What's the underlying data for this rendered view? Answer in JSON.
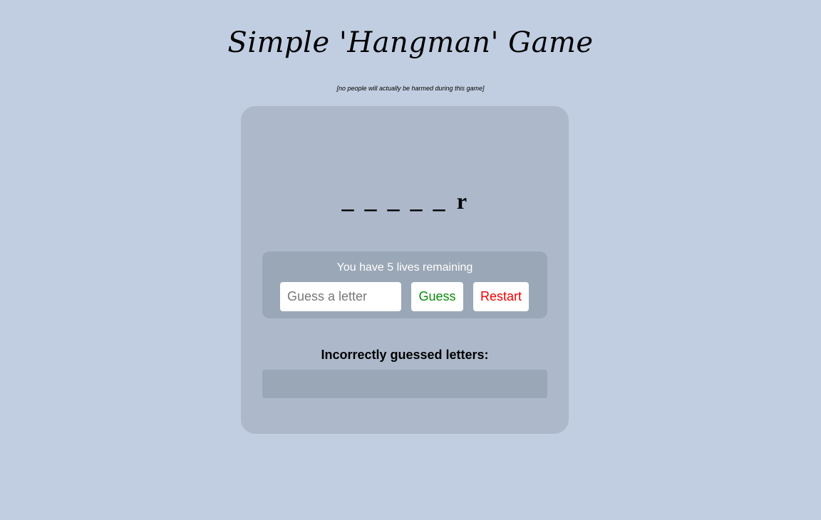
{
  "header": {
    "title": "Simple 'Hangman' Game",
    "subtitle": "[no people will actually be harmed during this game]"
  },
  "word": {
    "slots": [
      "_",
      "_",
      "_",
      "_",
      "_",
      "r"
    ]
  },
  "controls": {
    "lives_text": "You have 5 lives remaining",
    "guess_placeholder": "Guess a letter",
    "guess_value": "",
    "guess_button_label": "Guess",
    "restart_button_label": "Restart"
  },
  "incorrect": {
    "label": "Incorrectly guessed letters:",
    "letters": ""
  },
  "colors": {
    "background": "#c1cee2",
    "card": "#adb9cb",
    "panel": "#9aa7b6",
    "guess_text": "#0a8a0a",
    "restart_text": "#ee0000"
  }
}
